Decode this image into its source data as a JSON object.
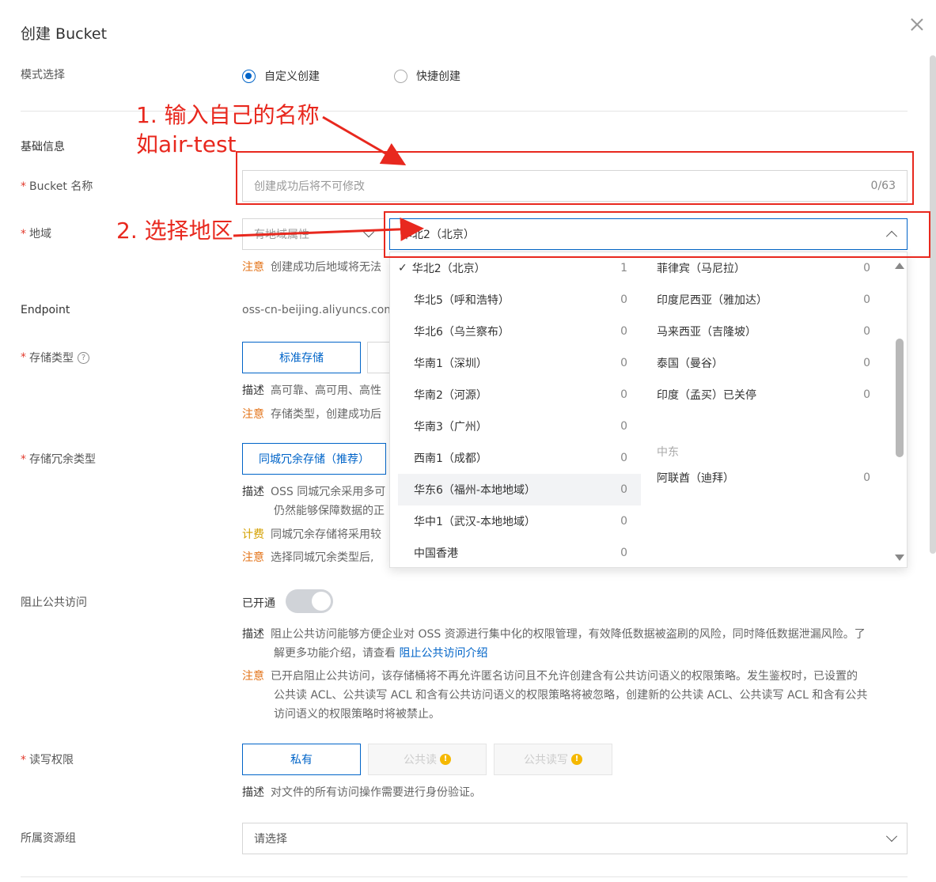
{
  "dialog": {
    "title": "创建 Bucket"
  },
  "mode": {
    "label": "模式选择",
    "options": [
      {
        "label": "自定义创建",
        "selected": true
      },
      {
        "label": "快捷创建",
        "selected": false
      }
    ]
  },
  "basic": {
    "section_label": "基础信息",
    "bucket_name_label": "Bucket 名称",
    "bucket_name_placeholder": "创建成功后将不可修改",
    "bucket_name_counter": "0/63",
    "region_label": "地域",
    "region_attr_placeholder": "有地域属性",
    "region_selected": "华北2（北京）",
    "region_note_tag": "注意",
    "region_note": "创建成功后地域将无法",
    "endpoint_label": "Endpoint",
    "endpoint_value": "oss-cn-beijing.aliyuncs.com"
  },
  "storage": {
    "label": "存储类型",
    "help_icon": "question-circle-icon",
    "option_standard": "标准存储",
    "desc_tag": "描述",
    "desc": "高可靠、高可用、高性",
    "note_tag": "注意",
    "note": "存储类型，创建成功后"
  },
  "redundancy": {
    "label": "存储冗余类型",
    "option": "同城冗余存储（推荐）",
    "desc_tag": "描述",
    "desc_line1": "OSS 同城冗余采用多可",
    "desc_line2": "仍然能够保障数据的正",
    "fee_tag": "计费",
    "fee": "同城冗余存储将采用较",
    "note_tag": "注意",
    "note": "选择同城冗余类型后,"
  },
  "region_dropdown": {
    "left_items": [
      {
        "label": "华北2（北京）",
        "count": "1",
        "checked": true
      },
      {
        "label": "华北5（呼和浩特）",
        "count": "0"
      },
      {
        "label": "华北6（乌兰察布）",
        "count": "0"
      },
      {
        "label": "华南1（深圳）",
        "count": "0"
      },
      {
        "label": "华南2（河源）",
        "count": "0"
      },
      {
        "label": "华南3（广州）",
        "count": "0"
      },
      {
        "label": "西南1（成都）",
        "count": "0"
      },
      {
        "label": "华东6（福州-本地地域）",
        "count": "0",
        "highlighted": true
      },
      {
        "label": "华中1（武汉-本地地域）",
        "count": "0"
      },
      {
        "label": "中国香港",
        "count": "0"
      }
    ],
    "right_items": [
      {
        "label": "菲律宾（马尼拉）",
        "count": "0"
      },
      {
        "label": "印度尼西亚（雅加达）",
        "count": "0"
      },
      {
        "label": "马来西亚（吉隆坡）",
        "count": "0"
      },
      {
        "label": "泰国（曼谷）",
        "count": "0"
      },
      {
        "label": "印度（孟买）已关停",
        "count": "0"
      }
    ],
    "group_middle_east": "中东",
    "middle_east_items": [
      {
        "label": "阿联酋（迪拜）",
        "count": "0"
      }
    ]
  },
  "public_access": {
    "label": "阻止公共访问",
    "toggle_label": "已开通",
    "desc_tag": "描述",
    "desc_line1": "阻止公共访问能够方便企业对 OSS 资源进行集中化的权限管理，有效降低数据被盗刷的风险，同时降低数据泄漏风险。了",
    "desc_line2_prefix": "解更多功能介绍，请查看",
    "desc_link": "阻止公共访问介绍",
    "note_tag": "注意",
    "note_line1": "已开启阻止公共访问，该存储桶将不再允许匿名访问且不允许创建含有公共访问语义的权限策略。发生鉴权时，已设置的",
    "note_line2": "公共读 ACL、公共读写 ACL 和含有公共访问语义的权限策略将被忽略，创建新的公共读 ACL、公共读写 ACL 和含有公共",
    "note_line3": "访问语义的权限策略时将被禁止。"
  },
  "acl": {
    "label": "读写权限",
    "options": [
      "私有",
      "公共读",
      "公共读写"
    ],
    "desc_tag": "描述",
    "desc": "对文件的所有访问操作需要进行身份验证。"
  },
  "resource_group": {
    "label": "所属资源组",
    "placeholder": "请选择"
  },
  "annotations": {
    "step1_line1": "1. 输入自己的名称",
    "step1_line2": "如air-test",
    "step2": "2. 选择地区",
    "color": "#e8281e"
  }
}
